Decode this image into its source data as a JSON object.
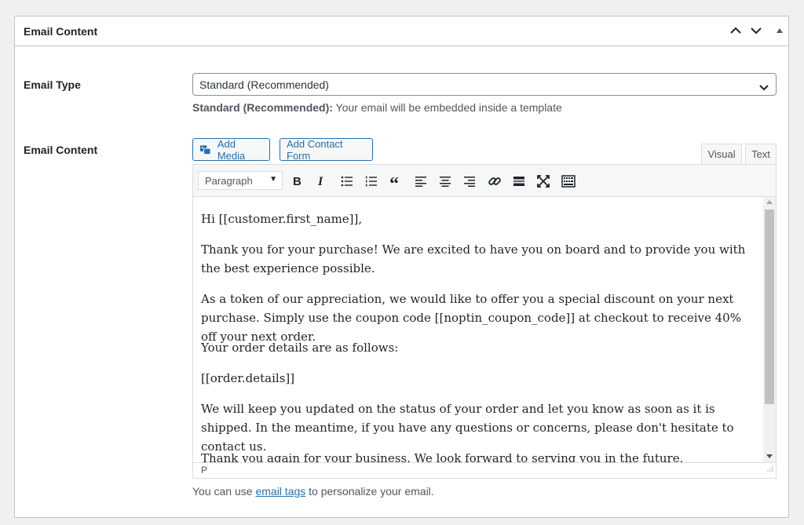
{
  "panel": {
    "title": "Email Content"
  },
  "email_type": {
    "label": "Email Type",
    "selected": "Standard (Recommended)",
    "help_bold": "Standard (Recommended):",
    "help_text": " Your email will be embedded inside a template"
  },
  "email_content": {
    "label": "Email Content",
    "add_media_label": "Add Media",
    "add_contact_form_label": "Add Contact Form",
    "tabs": [
      {
        "label": "Visual",
        "active": true
      },
      {
        "label": "Text",
        "active": false
      }
    ],
    "format_select": "Paragraph",
    "paragraphs": [
      "Hi [[customer.first_name]],",
      "Thank you for your purchase! We are excited to have you on board and to provide you with the best experience possible.",
      "As a token of our appreciation, we would like to offer you a special discount on your next purchase. Simply use the coupon code [[noptin_coupon_code]] at checkout to receive 40% off your next order.",
      "Your order details are as follows:",
      "[[order.details]]",
      "We will keep you updated on the status of your order and let you know as soon as it is shipped. In the meantime, if you have any questions or concerns, please don't hesitate to contact us.",
      "Thank you again for your business. We look forward to serving you in the future."
    ],
    "status_path": "P",
    "footer_before": "You can use ",
    "footer_link": "email tags",
    "footer_after": " to personalize your email."
  },
  "colors": {
    "link": "#2271b1",
    "border": "#c3c4c7",
    "background": "#f0f0f1"
  }
}
